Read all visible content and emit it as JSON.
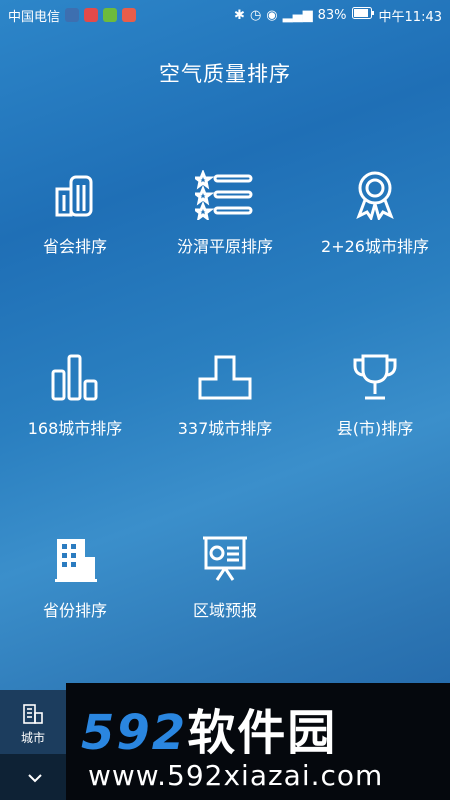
{
  "status_bar": {
    "carrier": "中国电信",
    "battery": "83%",
    "time": "中午11:43"
  },
  "page": {
    "title": "空气质量排序"
  },
  "items": [
    {
      "label": "省会排序",
      "icon": "building-icon"
    },
    {
      "label": "汾渭平原排序",
      "icon": "star-list-icon"
    },
    {
      "label": "2+26城市排序",
      "icon": "medal-icon"
    },
    {
      "label": "168城市排序",
      "icon": "bar-chart-icon"
    },
    {
      "label": "337城市排序",
      "icon": "step-shape-icon"
    },
    {
      "label": "县(市)排序",
      "icon": "trophy-icon"
    },
    {
      "label": "省份排序",
      "icon": "office-building-icon"
    },
    {
      "label": "区域预报",
      "icon": "presentation-board-icon"
    }
  ],
  "bottom_nav": {
    "city_label": "城市"
  },
  "watermark": {
    "brand_num": "592",
    "brand_cn": "软件园",
    "url": "www.592xiazai.com"
  },
  "colors": {
    "accent": "#2a86e0",
    "background": "#2a7fc0"
  }
}
